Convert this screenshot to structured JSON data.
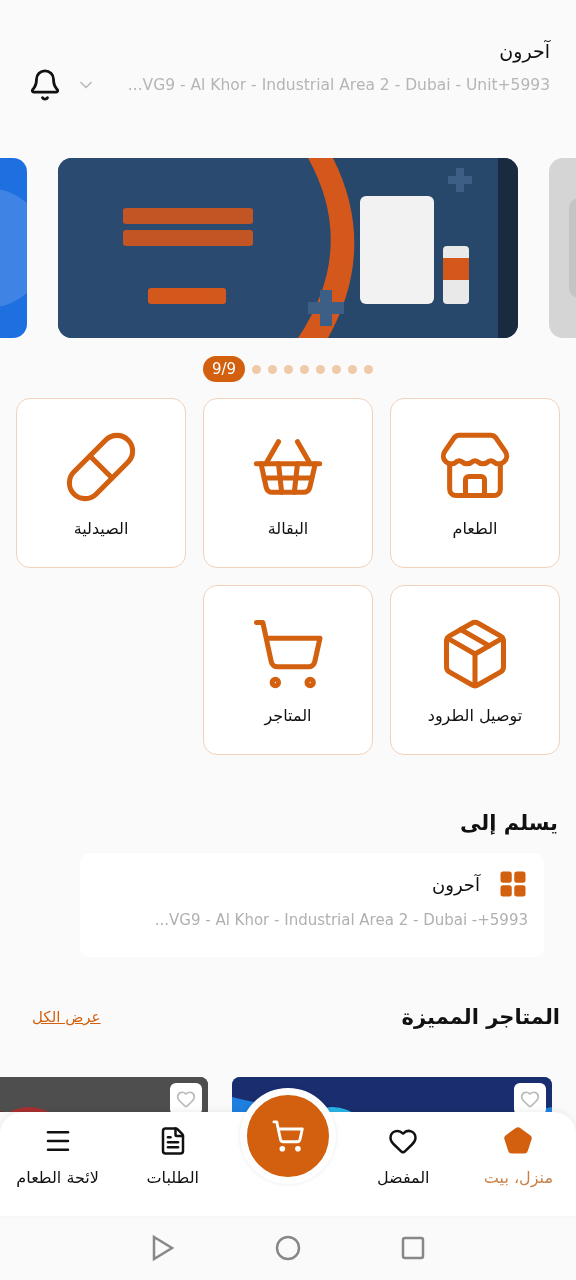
{
  "header": {
    "name": "آحرون",
    "address": "...VG9 - Al Khor - Industrial Area 2 - Dubai - Unit+5993"
  },
  "carousel": {
    "pager_label": "9/9",
    "pages": [
      {
        "selected": false
      },
      {
        "selected": false
      },
      {
        "selected": false
      },
      {
        "selected": false
      },
      {
        "selected": false
      },
      {
        "selected": false
      },
      {
        "selected": false
      },
      {
        "selected": false
      },
      {
        "selected": true
      }
    ]
  },
  "categories": [
    {
      "label": "الطعام"
    },
    {
      "label": "البقالة"
    },
    {
      "label": "الصيدلية"
    },
    {
      "label": "توصيل الطرود"
    },
    {
      "label": "المتاجر"
    }
  ],
  "delivery": {
    "title": "يسلم إلى",
    "name": "آحرون",
    "address": "...VG9 - Al Khor - Industrial Area 2 - Dubai -+5993"
  },
  "featured": {
    "title": "المتاجر المميزة",
    "view_all": "عرض الكل"
  },
  "bottom_nav": [
    {
      "label": "منزل، بيت",
      "selected": true
    },
    {
      "label": "المفضل",
      "selected": false
    },
    {
      "label": "الطلبات",
      "selected": false
    },
    {
      "label": "لائحة الطعام",
      "selected": false
    }
  ]
}
